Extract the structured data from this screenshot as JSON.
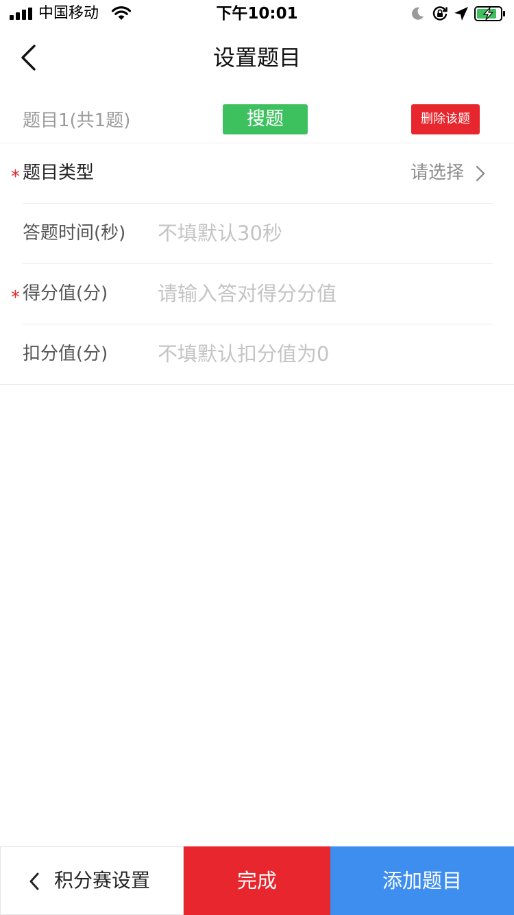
{
  "status_bar": {
    "carrier": "中国移动",
    "time": "下午10:01",
    "icons": [
      "signal-icon",
      "wifi-icon",
      "moon-icon",
      "orientation-lock-icon",
      "location-icon",
      "battery-charging-icon"
    ]
  },
  "nav": {
    "title": "设置题目",
    "back_icon": "chevron-left-icon"
  },
  "question": {
    "index_label": "题目1(共1题)",
    "search_label": "搜题",
    "delete_label": "删除该题"
  },
  "form": {
    "required_mark": "*",
    "type": {
      "label": "题目类型",
      "value": "请选择",
      "arrow_icon": "chevron-right-icon"
    },
    "time": {
      "label": "答题时间(秒)",
      "placeholder": "不填默认30秒"
    },
    "score": {
      "label": "得分值(分)",
      "placeholder": "请输入答对得分分值"
    },
    "deduct": {
      "label": "扣分值(分)",
      "placeholder": "不填默认扣分值为0"
    }
  },
  "bottom": {
    "back_label": "积分赛设置",
    "done_label": "完成",
    "add_label": "添加题目"
  },
  "colors": {
    "green": "#3dc15f",
    "red": "#e8262d",
    "blue": "#3e8ef0",
    "placeholder": "#c4c4c4",
    "muted_text": "#8d8d8d"
  }
}
